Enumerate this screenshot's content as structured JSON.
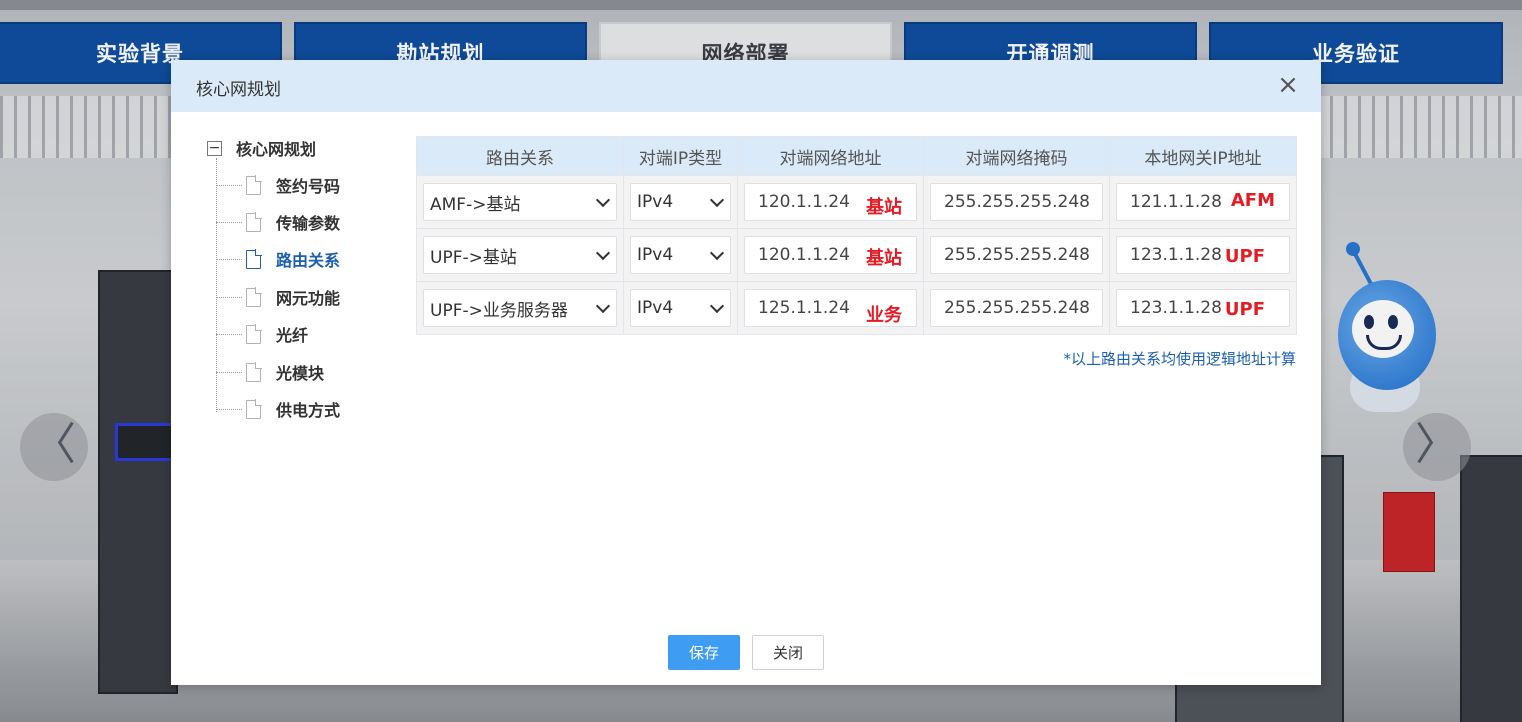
{
  "nav": {
    "tabs": [
      "实验背景",
      "勘站规划",
      "网络部署",
      "开通调测",
      "业务验证"
    ],
    "active_index": 2
  },
  "background": {
    "prev_arrow": "〈",
    "next_arrow": "〉"
  },
  "modal": {
    "title": "核心网规划",
    "close_icon": "×",
    "tree": {
      "toggle": "−",
      "root": "核心网规划",
      "items": [
        "签约号码",
        "传输参数",
        "路由关系",
        "网元功能",
        "光纤",
        "光模块",
        "供电方式"
      ],
      "selected_index": 2
    },
    "table": {
      "headers": [
        "路由关系",
        "对端IP类型",
        "对端网络地址",
        "对端网络掩码",
        "本地网关IP地址"
      ],
      "rows": [
        {
          "route": "AMF->基站",
          "ip_type": "IPv4",
          "peer_addr": "120.1.1.24",
          "peer_tag": "基站",
          "mask": "255.255.255.248",
          "gateway": "121.1.1.28",
          "gateway_tag": "AFM"
        },
        {
          "route": "UPF->基站",
          "ip_type": "IPv4",
          "peer_addr": "120.1.1.24",
          "peer_tag": "基站",
          "mask": "255.255.255.248",
          "gateway": "123.1.1.28",
          "gateway_tag": "UPF"
        },
        {
          "route": "UPF->业务服务器",
          "ip_type": "IPv4",
          "peer_addr": "125.1.1.24",
          "peer_tag": "业务",
          "mask": "255.255.255.248",
          "gateway": "123.1.1.28",
          "gateway_tag": "UPF"
        }
      ]
    },
    "note": "*以上路由关系均使用逻辑地址计算",
    "buttons": {
      "save": "保存",
      "close": "关闭"
    }
  },
  "colors": {
    "header_bg": "#daeaf8",
    "accent_blue": "#1c5fb0",
    "tag_red": "#e51c23",
    "save_btn": "#3e9cf2",
    "nav_blue": "#0f4fa0"
  }
}
